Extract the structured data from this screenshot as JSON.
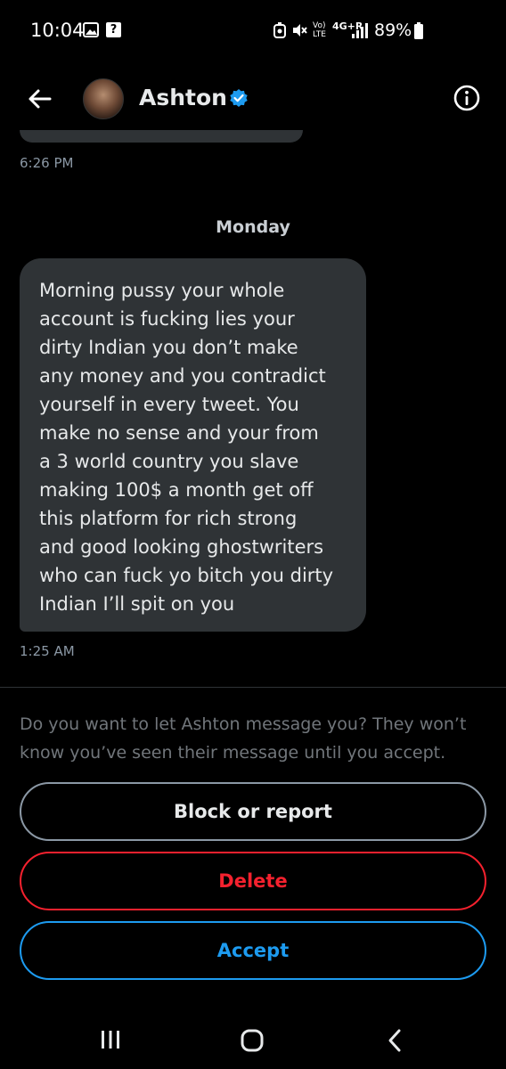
{
  "status_bar": {
    "time": "10:04",
    "volte": "Vo)\nLTE",
    "network": "4G+R",
    "battery": "89%"
  },
  "header": {
    "contact_name": "Ashton",
    "verified": true
  },
  "chat": {
    "previous_message_time": "6:26 PM",
    "day_separator": "Monday",
    "message": {
      "text": "Morning pussy your whole\naccount is fucking lies your\ndirty Indian you don’t make\nany money and you contradict\nyourself in every tweet. You\nmake no sense and your from\na 3 world country you slave\nmaking 100$ a month get off\nthis platform for rich strong\nand good looking ghostwriters\nwho can fuck yo bitch you dirty\nIndian I’ll spit on you",
      "time": "1:25 AM"
    }
  },
  "request": {
    "prompt": "Do you want to let Ashton message you? They won’t know you’ve seen their message until you accept.",
    "block_label": "Block or report",
    "delete_label": "Delete",
    "accept_label": "Accept"
  },
  "colors": {
    "background": "#000000",
    "bubble": "#2f3336",
    "accent_blue": "#1d9bf0",
    "danger_red": "#f4212e",
    "muted_text": "#71767b"
  },
  "icons": [
    "gallery-icon",
    "help-icon",
    "alarm-icon",
    "mute-icon",
    "signal-icon",
    "battery-icon",
    "back-arrow-icon",
    "verified-badge-icon",
    "info-icon",
    "nav-recent-apps-icon",
    "nav-home-icon",
    "nav-back-icon"
  ]
}
